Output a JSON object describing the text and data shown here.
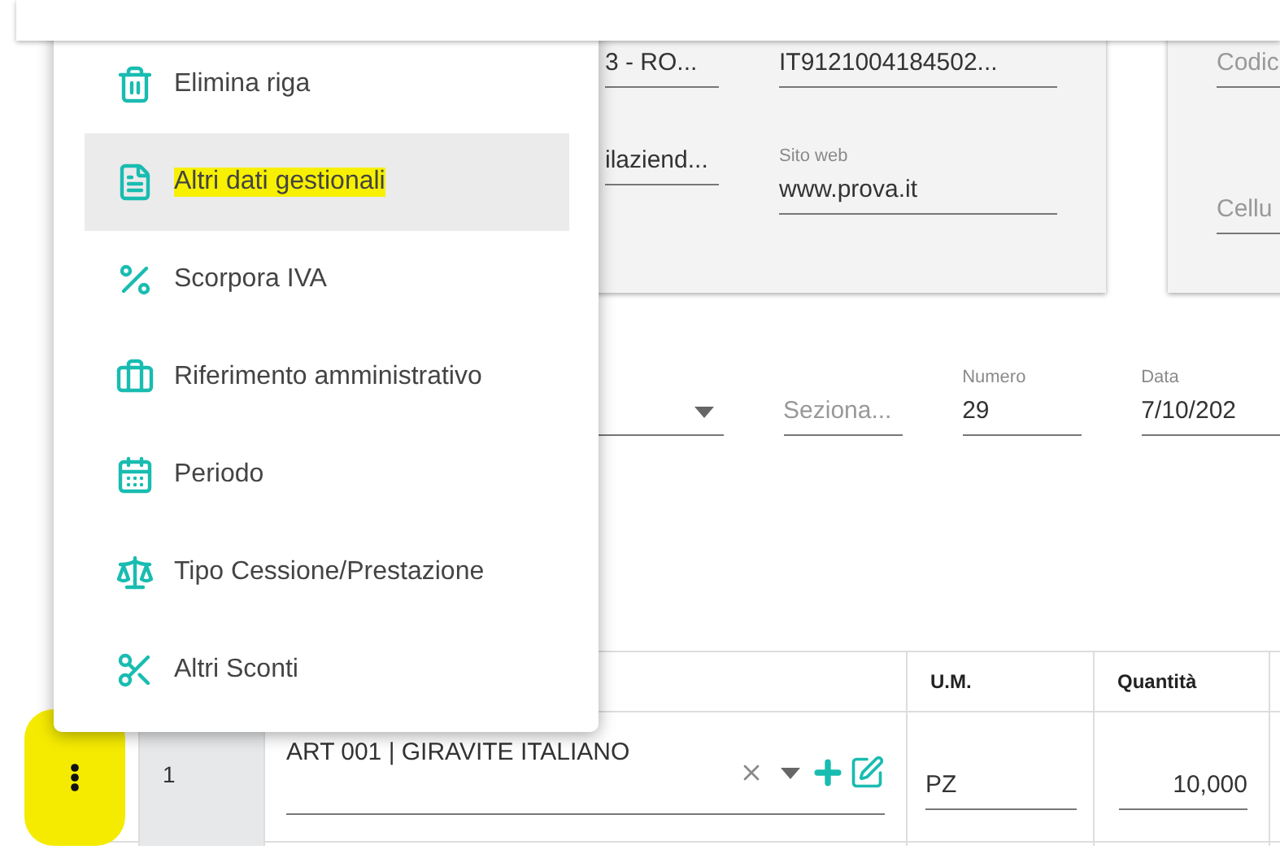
{
  "header_card": {
    "fields": [
      {
        "value": "3 - RO..."
      },
      {
        "value": "IT9121004184502..."
      },
      {
        "value": "ilaziend..."
      },
      {
        "label": "Sito web",
        "value": "www.prova.it"
      }
    ],
    "side_fields": [
      {
        "placeholder": "Codic"
      },
      {
        "placeholder": "Cellu"
      }
    ]
  },
  "document": {
    "sezionale": {
      "placeholder": "Seziona..."
    },
    "numero": {
      "label": "Numero",
      "value": "29"
    },
    "data": {
      "label": "Data",
      "value": "7/10/202"
    }
  },
  "table": {
    "columns": [
      {
        "label": "U.M."
      },
      {
        "label": "Quantità"
      }
    ],
    "rows": [
      {
        "index": "1",
        "article": "ART 001 | GIRAVITE ITALIANO",
        "um": "PZ",
        "quantity": "10,000",
        "menu_highlighted": true
      }
    ]
  },
  "context_menu": {
    "items": [
      {
        "kind": "delete",
        "label": "Elimina riga",
        "selected": false,
        "highlighted": false
      },
      {
        "kind": "document",
        "label": "Altri dati gestionali",
        "selected": true,
        "highlighted": true
      },
      {
        "kind": "percent",
        "label": "Scorpora IVA",
        "selected": false,
        "highlighted": false
      },
      {
        "kind": "briefcase",
        "label": "Riferimento amministrativo",
        "selected": false,
        "highlighted": false
      },
      {
        "kind": "calendar",
        "label": "Periodo",
        "selected": false,
        "highlighted": false
      },
      {
        "kind": "scale",
        "label": "Tipo Cessione/Prestazione",
        "selected": false,
        "highlighted": false
      },
      {
        "kind": "scissors",
        "label": "Altri Sconti",
        "selected": false,
        "highlighted": false
      }
    ]
  }
}
